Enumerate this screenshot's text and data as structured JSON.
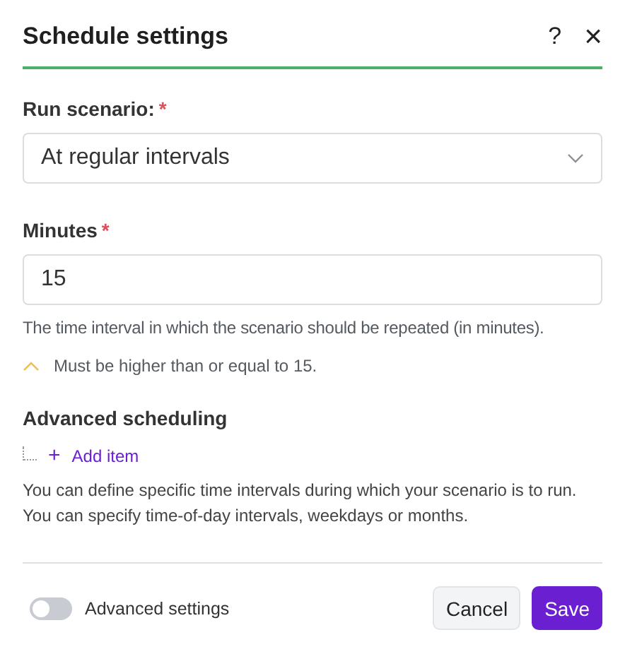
{
  "dialog": {
    "title": "Schedule settings",
    "help_icon": "?",
    "close_icon": "×"
  },
  "fields": [
    {
      "kind": "select",
      "label": "Run scenario:",
      "required_mark": "*",
      "value": "At regular intervals"
    },
    {
      "kind": "input",
      "label": "Minutes",
      "required_mark": "*",
      "value": "15",
      "help": "The time interval in which the scenario should be repeated (in minutes).",
      "warning": "Must be higher than or equal to 15."
    }
  ],
  "advanced_scheduling": {
    "heading": "Advanced scheduling",
    "add_label": "+",
    "add_text": "Add item",
    "description": "You can define specific time intervals during which your scenario is to run. You can specify time-of-day intervals, weekdays or months."
  },
  "footer": {
    "toggle": {
      "label": "Advanced settings",
      "on": false
    },
    "buttons": [
      {
        "kind": "secondary",
        "label": "Cancel"
      },
      {
        "kind": "primary",
        "label": "Save"
      }
    ]
  }
}
